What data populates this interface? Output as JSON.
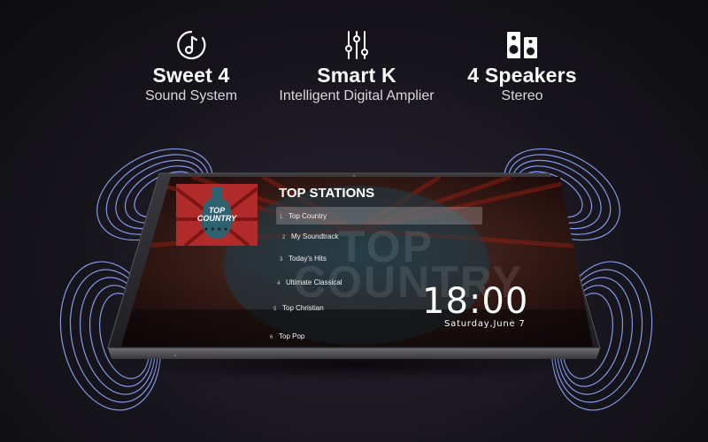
{
  "features": [
    {
      "icon": "music-note-circle-icon",
      "title": "Sweet 4",
      "subtitle": "Sound System"
    },
    {
      "icon": "equalizer-sliders-icon",
      "title": "Smart K",
      "subtitle": "Intelligent Digital Amplier"
    },
    {
      "icon": "speaker-icon",
      "title": "4 Speakers",
      "subtitle": "Stereo"
    }
  ],
  "screen": {
    "cover": {
      "title": "TOP COUNTRY",
      "title_line1": "TOP",
      "title_line2": "COUNTRY",
      "stars": "★★★★"
    },
    "background_word_1": "TOP",
    "background_word_2": "COUNTRY",
    "heading": "TOP STATIONS",
    "stations": [
      {
        "num": "1",
        "label": "Top Country",
        "active": true
      },
      {
        "num": "2",
        "label": "My Soundtrack"
      },
      {
        "num": "3",
        "label": "Today's Hits"
      },
      {
        "num": "4",
        "label": "Ultimate Classical"
      },
      {
        "num": "5",
        "label": "Top Christian"
      },
      {
        "num": "6",
        "label": "Top Pop"
      }
    ],
    "clock": "18:00",
    "date": "Saturday,June 7"
  },
  "colors": {
    "wave": "#8fa8ff",
    "cover_red": "#b22b2b",
    "screen_red": "#7a1a12"
  }
}
